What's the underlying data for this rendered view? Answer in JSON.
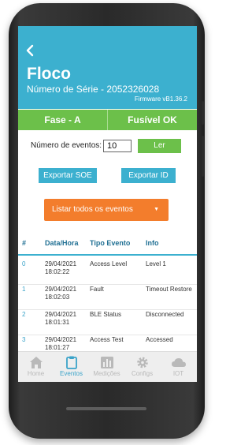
{
  "header": {
    "back_icon": "chevron-left-icon",
    "title": "Floco",
    "serial": "Número de Série - 2052326028",
    "firmware": "Firmware vB1.36.2"
  },
  "status": {
    "phase": "Fase - A",
    "fuse": "Fusível OK",
    "color": "#6cc04a"
  },
  "events_count": {
    "label": "Número de eventos:",
    "value": "10",
    "read_button": "Ler"
  },
  "actions": {
    "export_soe": "Exportar SOE",
    "export_id": "Exportar ID",
    "list_all": "Listar todos os eventos"
  },
  "table": {
    "headers": [
      "#",
      "Data/Hora",
      "Tipo Evento",
      "Info"
    ],
    "rows": [
      {
        "id": "0",
        "date": "29/04/2021",
        "time": "18:02:22",
        "type": "Access Level",
        "info": "Level 1"
      },
      {
        "id": "1",
        "date": "29/04/2021",
        "time": "18:02:03",
        "type": "Fault",
        "info": "Timeout Restore"
      },
      {
        "id": "2",
        "date": "29/04/2021",
        "time": "18:01:31",
        "type": "BLE Status",
        "info": "Disconnected"
      },
      {
        "id": "3",
        "date": "29/04/2021",
        "time": "18:01:27",
        "type": "Access Test",
        "info": "Accessed"
      }
    ]
  },
  "nav": {
    "items": [
      {
        "label": "Home",
        "icon": "home-icon"
      },
      {
        "label": "Eventos",
        "icon": "clipboard-icon",
        "active": true
      },
      {
        "label": "Medições",
        "icon": "bar-chart-icon"
      },
      {
        "label": "Configs",
        "icon": "gear-icon"
      },
      {
        "label": "IOT",
        "icon": "cloud-icon"
      }
    ]
  },
  "colors": {
    "accent": "#3cb0cf",
    "success": "#6cc04a",
    "orange": "#f37d2c"
  }
}
